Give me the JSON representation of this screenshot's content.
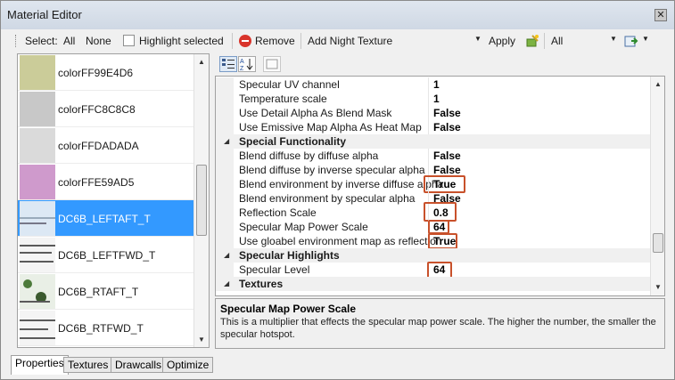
{
  "window": {
    "title": "Material Editor",
    "close": "✕"
  },
  "toolbar": {
    "select_label": "Select:",
    "all": "All",
    "none": "None",
    "highlight": "Highlight selected",
    "remove": "Remove",
    "texture_select": "Add Night Texture",
    "apply": "Apply",
    "filter_select": "All"
  },
  "materials": [
    {
      "label": "colorFF99E4D6",
      "swatch": "#cbcc99"
    },
    {
      "label": "colorFFC8C8C8",
      "swatch": "#c8c8c8"
    },
    {
      "label": "colorFFDADADA",
      "swatch": "#dadada"
    },
    {
      "label": "colorFFE59AD5",
      "swatch": "#cf9acc"
    },
    {
      "label": "DC6B_LEFTAFT_T",
      "selected": true
    },
    {
      "label": "DC6B_LEFTFWD_T"
    },
    {
      "label": "DC6B_RTAFT_T"
    },
    {
      "label": "DC6B_RTFWD_T"
    }
  ],
  "properties": [
    {
      "name": "Specular UV channel",
      "value": "1"
    },
    {
      "name": "Temperature scale",
      "value": "1"
    },
    {
      "name": "Use Detail Alpha As Blend Mask",
      "value": "False"
    },
    {
      "name": "Use Emissive Map Alpha As Heat Map",
      "value": "False"
    },
    {
      "category": true,
      "name": "Special Functionality"
    },
    {
      "name": "Blend diffuse by diffuse alpha",
      "value": "False"
    },
    {
      "name": "Blend diffuse by inverse specular alpha",
      "value": "False"
    },
    {
      "name": "Blend environment by inverse diffuse alpha",
      "value": "True",
      "highlight": true
    },
    {
      "name": "Blend environment by specular alpha",
      "value": "False"
    },
    {
      "name": "Reflection Scale",
      "value": "0.8",
      "highlight": true
    },
    {
      "name": "Specular Map Power Scale",
      "value": "64",
      "highlight": true
    },
    {
      "name": "Use gloabel environment map as reflection",
      "value": "True",
      "highlight": true
    },
    {
      "category": true,
      "name": "Specular Highlights"
    },
    {
      "name": "Specular Level",
      "value": "64",
      "highlight": true
    },
    {
      "category": true,
      "name": "Textures"
    }
  ],
  "description": {
    "title": "Specular Map Power Scale",
    "text": "This is a multiplier that effects the specular map power scale. The higher the number, the smaller the specular hotspot."
  },
  "tabs": [
    {
      "label": "Properties",
      "active": true
    },
    {
      "label": "Textures"
    },
    {
      "label": "Drawcalls"
    },
    {
      "label": "Optimize"
    }
  ],
  "colors": {
    "highlight_border": "#c8512b",
    "selection": "#3399ff"
  }
}
